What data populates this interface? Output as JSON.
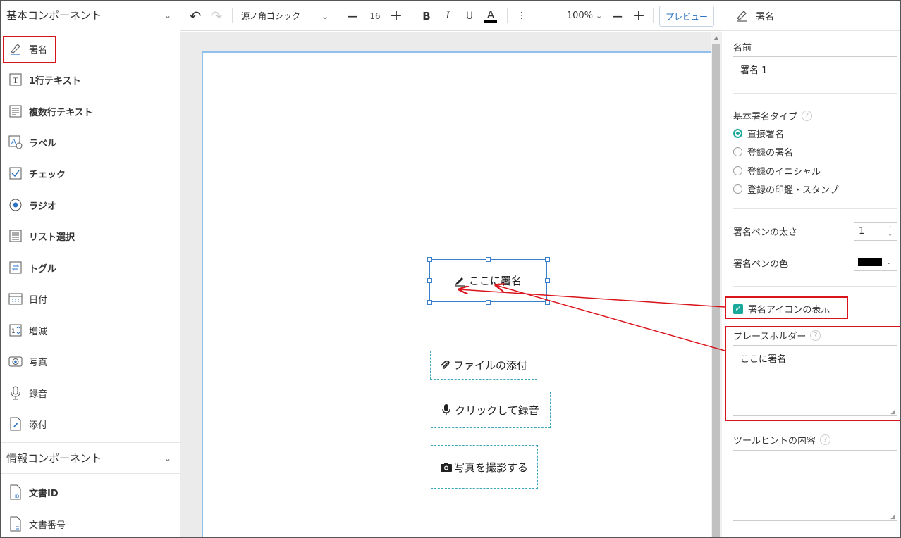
{
  "left_panel": {
    "basic_section": {
      "title": "基本コンポーネント"
    },
    "components": [
      {
        "label": "署名",
        "icon": "pen-icon"
      },
      {
        "label": "1行テキスト",
        "icon": "text-icon"
      },
      {
        "label": "複数行テキスト",
        "icon": "multiline-text-icon"
      },
      {
        "label": "ラベル",
        "icon": "label-icon"
      },
      {
        "label": "チェック",
        "icon": "checkbox-icon"
      },
      {
        "label": "ラジオ",
        "icon": "radio-icon"
      },
      {
        "label": "リスト選択",
        "icon": "list-icon"
      },
      {
        "label": "トグル",
        "icon": "toggle-icon"
      },
      {
        "label": "日付",
        "icon": "calendar-icon"
      },
      {
        "label": "増減",
        "icon": "increment-icon"
      },
      {
        "label": "写真",
        "icon": "camera-icon"
      },
      {
        "label": "録音",
        "icon": "microphone-icon"
      },
      {
        "label": "添付",
        "icon": "attachment-icon"
      }
    ],
    "info_section": {
      "title": "情報コンポーネント"
    },
    "info_components": [
      {
        "label": "文書ID",
        "icon": "document-id-icon"
      },
      {
        "label": "文書番号",
        "icon": "document-number-icon"
      }
    ]
  },
  "toolbar": {
    "font": "源ノ角ゴシック",
    "font_size": "16",
    "bold": "B",
    "italic": "I",
    "underline": "U",
    "font_color": "A",
    "more": "⋮",
    "zoom": "100%",
    "preview": "プレビュー"
  },
  "canvas": {
    "signature_placeholder": "ここに署名",
    "attach_button": "ファイルの添付",
    "record_button": "クリックして録音",
    "photo_button": "写真を撮影する"
  },
  "properties": {
    "header": "署名",
    "name_label": "名前",
    "name_value": "署名 1",
    "type_label": "基本署名タイプ",
    "type_options": [
      "直接署名",
      "登録の署名",
      "登録のイニシャル",
      "登録の印鑑・スタンプ"
    ],
    "type_selected": "直接署名",
    "pen_width_label": "署名ペンの太さ",
    "pen_width_value": "1",
    "pen_color_label": "署名ペンの色",
    "pen_color_value": "#000000",
    "show_icon_label": "署名アイコンの表示",
    "show_icon_checked": true,
    "placeholder_label": "プレースホルダー",
    "placeholder_value": "ここに署名",
    "tooltip_label": "ツールヒントの内容",
    "tooltip_value": ""
  },
  "colors": {
    "accent": "#1aa89b",
    "selection": "#3a7fc9",
    "highlight": "#d9131a",
    "link": "#2e74c4"
  }
}
